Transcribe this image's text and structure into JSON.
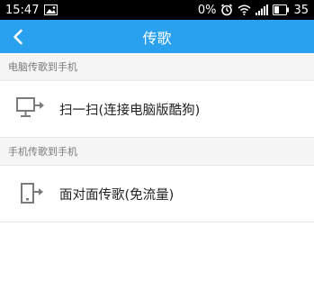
{
  "status_bar": {
    "time": "15:47",
    "battery_text": "0%",
    "battery_level": "35"
  },
  "nav": {
    "title": "传歌",
    "back_icon": "chevron-left-icon"
  },
  "sections": [
    {
      "header": "电脑传歌到手机",
      "item": {
        "label": "扫一扫(连接电脑版酷狗)",
        "icon": "computer-transfer-icon"
      }
    },
    {
      "header": "手机传歌到手机",
      "item": {
        "label": "面对面传歌(免流量)",
        "icon": "phone-transfer-icon"
      }
    }
  ],
  "colors": {
    "accent": "#2aa1ee",
    "icon_gray": "#7b7b7b"
  }
}
